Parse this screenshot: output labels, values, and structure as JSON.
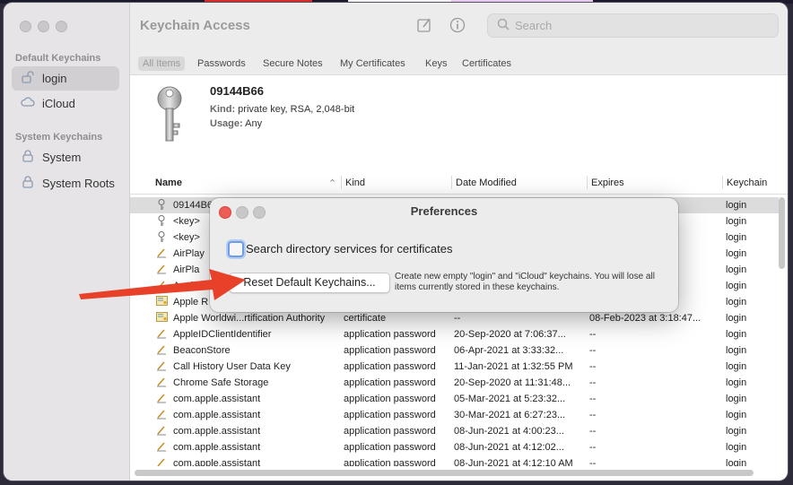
{
  "app": {
    "title": "Keychain Access"
  },
  "sidebar": {
    "default_section": "Default Keychains",
    "system_section": "System Keychains",
    "items": [
      {
        "label": "login",
        "icon": "unlock-icon"
      },
      {
        "label": "iCloud",
        "icon": "cloud-icon"
      },
      {
        "label": "System",
        "icon": "lock-icon"
      },
      {
        "label": "System Roots",
        "icon": "lock-icon"
      }
    ]
  },
  "search": {
    "placeholder": "Search"
  },
  "tabs": [
    "All Items",
    "Passwords",
    "Secure Notes",
    "My Certificates",
    "Keys",
    "Certificates"
  ],
  "detail": {
    "name": "09144B66",
    "kind_label": "Kind:",
    "kind_value": "private key, RSA, 2,048-bit",
    "usage_label": "Usage:",
    "usage_value": "Any"
  },
  "columns": {
    "name": "Name",
    "kind": "Kind",
    "date": "Date Modified",
    "expires": "Expires",
    "keychain": "Keychain"
  },
  "rows": [
    {
      "icon": "key-icon",
      "name": "09144B66",
      "kind": "",
      "date": "",
      "expires": "",
      "keychain": "login"
    },
    {
      "icon": "key-icon",
      "name": "<key>",
      "kind": "",
      "date": "",
      "expires": "",
      "keychain": "login"
    },
    {
      "icon": "key-icon",
      "name": "<key>",
      "kind": "",
      "date": "",
      "expires": "",
      "keychain": "login"
    },
    {
      "icon": "pen-icon",
      "name": "AirPlay",
      "kind": "",
      "date": "",
      "expires": "",
      "keychain": "login"
    },
    {
      "icon": "pen-icon",
      "name": "AirPla",
      "kind": "",
      "date": "",
      "expires": "",
      "keychain": "login"
    },
    {
      "icon": "pen-icon",
      "name": "Apple",
      "kind": "",
      "date": "",
      "expires": "",
      "keychain": "login"
    },
    {
      "icon": "cert-icon",
      "name": "Apple R",
      "kind": "",
      "date": "",
      "expires": "0:36:",
      "keychain": "login"
    },
    {
      "icon": "cert-icon",
      "name": "Apple Worldwi...rtification Authority",
      "kind": "certificate",
      "date": "--",
      "expires": "08-Feb-2023 at 3:18:47...",
      "keychain": "login"
    },
    {
      "icon": "pen-icon",
      "name": "AppleIDClientIdentifier",
      "kind": "application password",
      "date": "20-Sep-2020 at 7:06:37...",
      "expires": "--",
      "keychain": "login"
    },
    {
      "icon": "pen-icon",
      "name": "BeaconStore",
      "kind": "application password",
      "date": "06-Apr-2021 at 3:33:32...",
      "expires": "--",
      "keychain": "login"
    },
    {
      "icon": "pen-icon",
      "name": "Call History User Data Key",
      "kind": "application password",
      "date": "11-Jan-2021 at 1:32:55 PM",
      "expires": "--",
      "keychain": "login"
    },
    {
      "icon": "pen-icon",
      "name": "Chrome Safe Storage",
      "kind": "application password",
      "date": "20-Sep-2020 at 11:31:48...",
      "expires": "--",
      "keychain": "login"
    },
    {
      "icon": "pen-icon",
      "name": "com.apple.assistant",
      "kind": "application password",
      "date": "05-Mar-2021 at 5:23:32...",
      "expires": "--",
      "keychain": "login"
    },
    {
      "icon": "pen-icon",
      "name": "com.apple.assistant",
      "kind": "application password",
      "date": "30-Mar-2021 at 6:27:23...",
      "expires": "--",
      "keychain": "login"
    },
    {
      "icon": "pen-icon",
      "name": "com.apple.assistant",
      "kind": "application password",
      "date": "08-Jun-2021 at 4:00:23...",
      "expires": "--",
      "keychain": "login"
    },
    {
      "icon": "pen-icon",
      "name": "com.apple.assistant",
      "kind": "application password",
      "date": "08-Jun-2021 at 4:12:02...",
      "expires": "--",
      "keychain": "login"
    },
    {
      "icon": "pen-icon",
      "name": "com.apple.assistant",
      "kind": "application password",
      "date": "08-Jun-2021 at 4:12:10 AM",
      "expires": "--",
      "keychain": "login"
    }
  ],
  "modal": {
    "title": "Preferences",
    "checkbox_label": "Search directory services for certificates",
    "checkbox_checked": false,
    "button_label": "Reset Default Keychains...",
    "description": "Create new empty \"login\" and \"iCloud\" keychains. You will lose all items currently stored in these keychains."
  },
  "colors": {
    "close": "#ee5c56",
    "minimize": "#c8c8c8",
    "arrow": "#e8412a",
    "checkbox_focus": "#6d9de4"
  }
}
